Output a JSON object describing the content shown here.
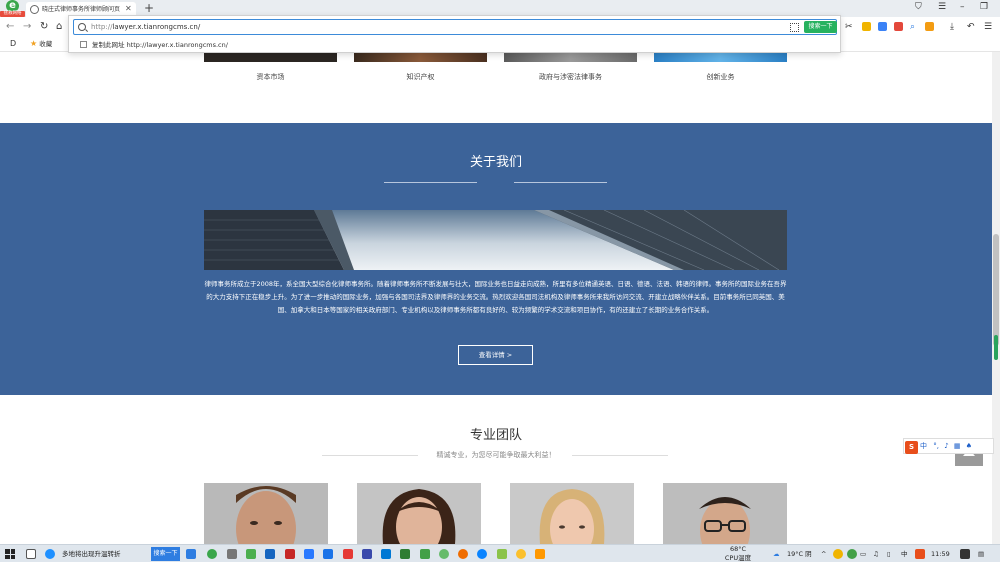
{
  "browser": {
    "badge": "拯救网络",
    "tab_title": "晓庄式律师事务所律师顾问页",
    "tab_close": "✕",
    "new_tab": "+",
    "address_url_prefix": "http://",
    "address_url_host": "lawyer.x.tianrongcms.cn/",
    "go_label": "搜索一下",
    "copy_label": "复制此网址 http://lawyer.x.tianrongcms.cn/",
    "favorites_label": "收藏",
    "bookmark_d": "D"
  },
  "practice_areas": [
    {
      "label": "资本市场"
    },
    {
      "label": "知识产权"
    },
    {
      "label": "政府与涉密法律事务"
    },
    {
      "label": "创新业务"
    }
  ],
  "about": {
    "title": "关于我们",
    "text": "律师事务所成立于2008年，系全国大型综合化律师事务所。随着律师事务所不断发展与壮大，国际业务也日益走向成熟，所里有多位精通英语、日语、德语、法语、韩语的律师。事务所的国际业务在吾界的大力支持下正在稳步上升。为了进一步推动的国际业务，加强与各国司法界及律师界的业务交流。热烈欢迎各国司法机构及律师事务所来我所访问交流、开建立战略伙伴关系。目前事务所已同英国、美国、加拿大和日本等国家的相关政府部门、专业机构以及律师事务所都有良好的、较为频繁的学术交流和项目协作，有的还建立了长期的业务合作关系。",
    "button": "查看详情 >"
  },
  "team": {
    "title": "专业团队",
    "subtitle": "精诚专业，为您尽可能争取最大利益！"
  },
  "ime": {
    "label": "中",
    "s": "S"
  },
  "taskbar": {
    "news": "多地将出现升温转折",
    "search": "搜索一下",
    "cpu_temp": "68°C",
    "cpu_label": "CPU温度",
    "weather": "19°C 阴",
    "lang": "中",
    "time": "11:59"
  },
  "colors": {
    "about_bg": "#3c6399",
    "go_button": "#27b25f"
  }
}
